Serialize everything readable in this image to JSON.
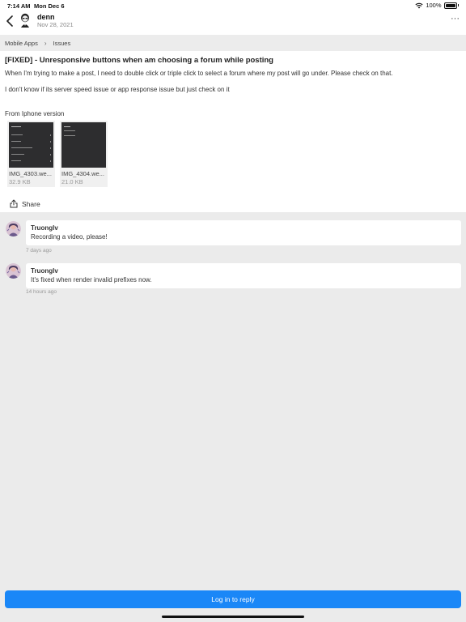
{
  "status_bar": {
    "time": "7:14 AM",
    "date": "Mon Dec 6",
    "battery": "100%"
  },
  "header": {
    "username": "denn",
    "date": "Nov 28, 2021",
    "more_label": "···"
  },
  "breadcrumb": {
    "items": [
      "Mobile Apps",
      "Issues"
    ],
    "separator": "›"
  },
  "post": {
    "title": "[FIXED] - Unresponsive buttons when am choosing a forum while posting",
    "paragraphs": [
      "When I'm trying to make a post, I need to double click or triple click to select a forum where my post will go under. Please check on that.",
      "I don't know if its server speed issue or app response issue but just check on it",
      "From Iphone version"
    ],
    "attachments": [
      {
        "name": "IMG_4303.we...",
        "size": "32.9 KB"
      },
      {
        "name": "IMG_4304.we...",
        "size": "21.0 KB"
      }
    ],
    "share_label": "Share"
  },
  "comments": [
    {
      "user": "Truonglv",
      "text": "Recording a video, please!",
      "time": "7 days ago"
    },
    {
      "user": "Truonglv",
      "text": "It's fixed when render invalid prefixes now.",
      "time": "14 hours ago"
    }
  ],
  "reply_button": "Log in to reply",
  "colors": {
    "accent": "#1a87f7",
    "background": "#ebebeb"
  }
}
